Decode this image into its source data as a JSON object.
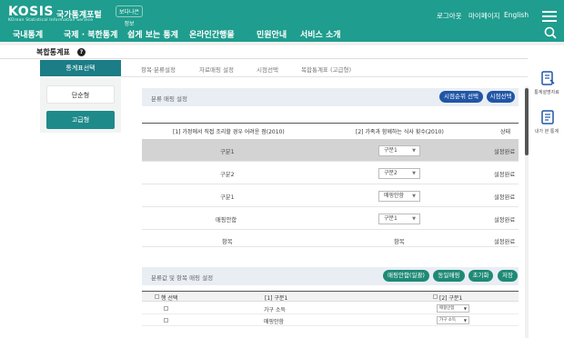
{
  "header": {
    "logo": "KOSIS",
    "logo_ko": "국가통계포털",
    "logo_sub": "KOrean Statistical Information Service",
    "badge": "보다나은 정보",
    "util_links": [
      "로그아웃",
      "마이페이지",
      "English"
    ],
    "nav": [
      "국내통계",
      "국제 · 북한통계",
      "쉽게 보는 통계",
      "온라인간행물",
      "민원안내",
      "서비스 소개"
    ]
  },
  "page": {
    "title": "복합통계표",
    "help": "?"
  },
  "tabs": {
    "selected": "통계표선택",
    "others": [
      "항목·분류설정",
      "자료매핑 설정",
      "시점선택",
      "복합통계표 (고급형)"
    ]
  },
  "left_panel": {
    "simple": "단순형",
    "advanced": "고급형"
  },
  "mapping": {
    "section_title": "분류 매핑 설정",
    "btn_order": "시점순위 선택",
    "btn_time": "시점선택",
    "col1": "[1] 가정에서 직접 조리할 경우 어려운 점(2010)",
    "col2": "[2] 가족과 함께하는 식사 횟수(2010)",
    "col3": "상태",
    "rows": [
      {
        "left": "구분1",
        "select": "구분1",
        "status": "설정완료"
      },
      {
        "left": "구분2",
        "select": "구분2",
        "status": "설정완료"
      },
      {
        "left": "구분1",
        "select": "매핑안함",
        "status": "설정완료"
      },
      {
        "left": "매핑안함",
        "select": "구분1",
        "status": "설정완료"
      },
      {
        "left": "항목",
        "select": "항목",
        "status": "설정완료"
      }
    ]
  },
  "value_mapping": {
    "section_title": "분류값 및 항목 매핑 설정",
    "btn_batch": "매핑안함(일괄)",
    "btn_same": "동일매핑",
    "btn_reset": "초기화",
    "btn_save": "저장",
    "head_select": "행 선택",
    "head_col1": "[1] 구분1",
    "head_col2": "[2] 구분1",
    "rows": [
      {
        "label": "가구 소득",
        "select": "매핑안함"
      },
      {
        "label": "매핑안함",
        "select": "가구 소득"
      }
    ]
  },
  "right_bar": {
    "item1": "통계설명자료",
    "item2": "내가 본 통계"
  },
  "colors": {
    "header": "#1f9d8e",
    "tab_selected": "#1b7d86",
    "pill_blue": "#2056a6",
    "pill_green": "#1e8a76"
  }
}
